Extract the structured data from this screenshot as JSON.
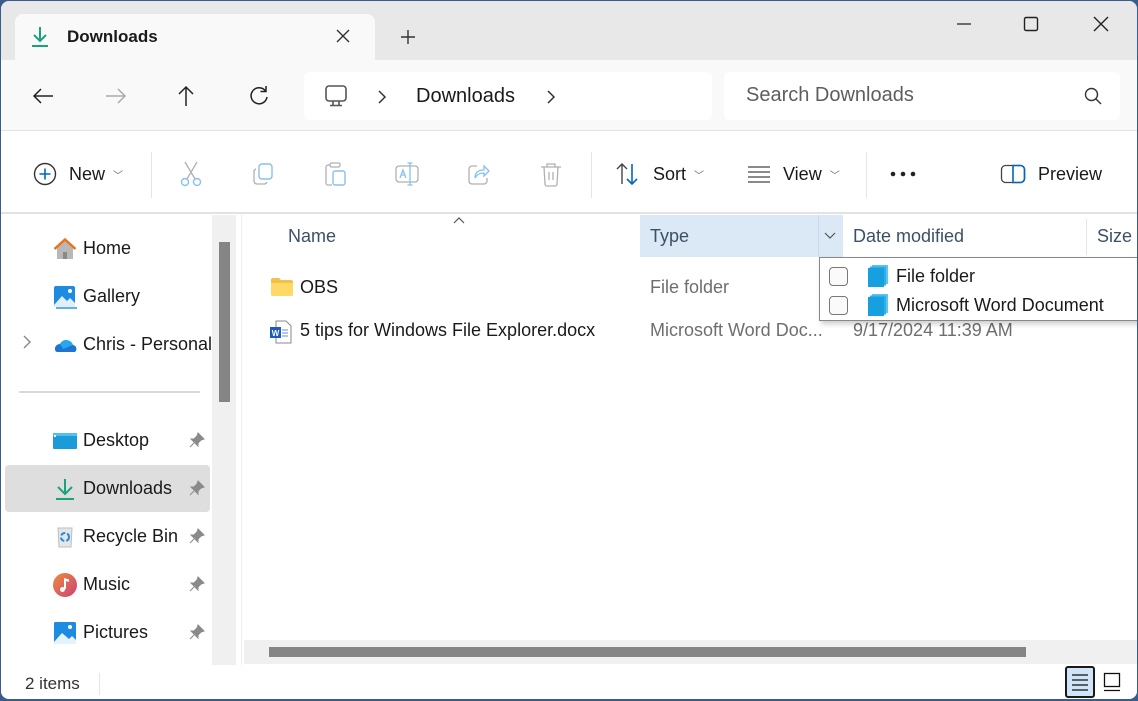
{
  "window": {
    "tab_title": "Downloads",
    "new_tab_label": "+",
    "controls": {
      "minimize": "minimize",
      "maximize": "maximize",
      "close": "close"
    }
  },
  "nav": {
    "breadcrumb": [
      "Downloads"
    ],
    "search_placeholder": "Search Downloads"
  },
  "toolbar": {
    "new_label": "New",
    "sort_label": "Sort",
    "view_label": "View",
    "more_label": "•••",
    "preview_label": "Preview",
    "disabled_actions": [
      "cut",
      "copy",
      "paste",
      "rename",
      "share",
      "delete"
    ]
  },
  "sidebar": {
    "top_items": [
      {
        "label": "Home",
        "icon": "home-icon"
      },
      {
        "label": "Gallery",
        "icon": "gallery-icon"
      },
      {
        "label": "Chris - Personal",
        "icon": "onedrive-icon",
        "expandable": true
      }
    ],
    "pinned_items": [
      {
        "label": "Desktop",
        "icon": "desktop-icon",
        "pinned": true
      },
      {
        "label": "Downloads",
        "icon": "downloads-icon",
        "pinned": true,
        "selected": true
      },
      {
        "label": "Recycle Bin",
        "icon": "recycle-bin-icon",
        "pinned": true
      },
      {
        "label": "Music",
        "icon": "music-icon",
        "pinned": true
      },
      {
        "label": "Pictures",
        "icon": "pictures-icon",
        "pinned": true
      }
    ]
  },
  "content": {
    "columns": {
      "name": "Name",
      "type": "Type",
      "date": "Date modified",
      "size": "Size"
    },
    "sorted_column": "Name",
    "filter_open_on": "Type",
    "files": [
      {
        "name": "OBS",
        "type": "File folder",
        "date": "",
        "icon": "folder-icon"
      },
      {
        "name": "5 tips for Windows File Explorer.docx",
        "type": "Microsoft Word Doc...",
        "date": "9/17/2024 11:39 AM",
        "icon": "word-doc-icon"
      }
    ],
    "type_filter_options": [
      {
        "label": "File folder",
        "checked": false
      },
      {
        "label": "Microsoft Word Document",
        "checked": false
      }
    ]
  },
  "status": {
    "item_count": "2 items",
    "active_view": "details"
  },
  "colors": {
    "accent": "#0067c0",
    "download_green": "#1aa37a",
    "selected_header": "#dbe8f5",
    "selected_sidebar": "#dedede"
  }
}
